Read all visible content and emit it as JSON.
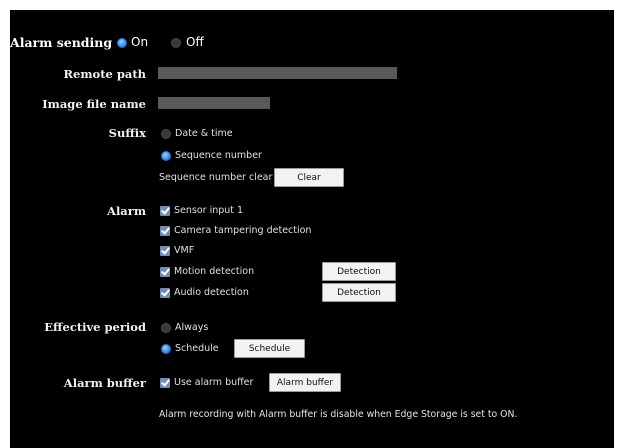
{
  "alarm_sending": {
    "label": "Alarm sending",
    "on_label": "On",
    "off_label": "Off",
    "selected": "On"
  },
  "remote_path": {
    "label": "Remote path",
    "value": ""
  },
  "image_file_name": {
    "label": "Image file name",
    "value": ""
  },
  "suffix": {
    "label": "Suffix",
    "options": [
      "Date & time",
      "Sequence number"
    ],
    "selected": "Sequence number",
    "seq_clear_label": "Sequence number clear",
    "clear_button": "Clear"
  },
  "alarm": {
    "label": "Alarm",
    "items": [
      {
        "label": "Sensor input 1",
        "checked": true
      },
      {
        "label": "Camera tampering detection",
        "checked": true
      },
      {
        "label": "VMF",
        "checked": true
      },
      {
        "label": "Motion detection",
        "checked": true,
        "button": "Detection"
      },
      {
        "label": "Audio detection",
        "checked": true,
        "button": "Detection"
      }
    ]
  },
  "effective_period": {
    "label": "Effective period",
    "options": [
      "Always",
      "Schedule"
    ],
    "selected": "Schedule",
    "schedule_button": "Schedule"
  },
  "alarm_buffer": {
    "label": "Alarm buffer",
    "use_label": "Use alarm buffer",
    "checked": true,
    "button": "Alarm buffer",
    "note": "Alarm recording with Alarm buffer is disable when Edge Storage is set to ON."
  },
  "colors": {
    "background": "#000000",
    "radio_selected": "#3e95ee",
    "checkbox": "#6f8db5",
    "field": "#595959",
    "button_bg": "#f2f2f2"
  }
}
